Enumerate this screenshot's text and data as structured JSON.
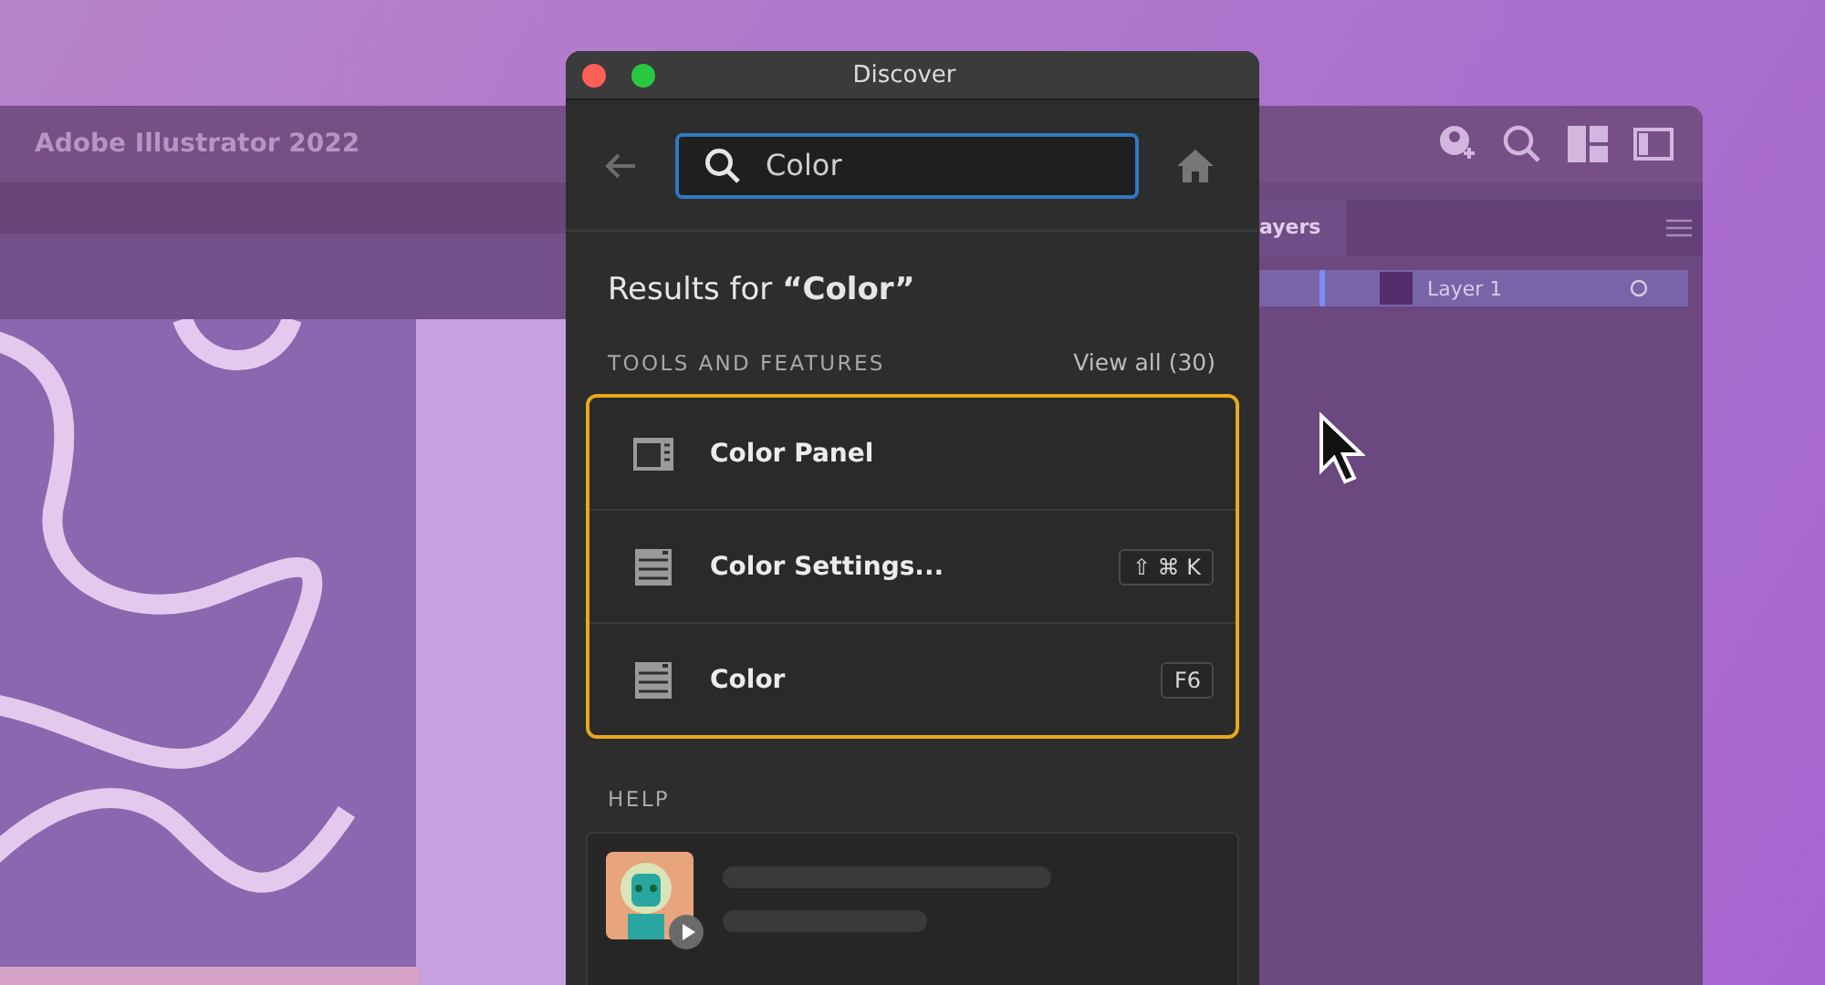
{
  "app_window": {
    "title": "Adobe Illustrator 2022",
    "layers_panel": {
      "tab": "ayers",
      "layers": [
        {
          "name": "Layer 1",
          "selected": true
        }
      ]
    }
  },
  "dialog": {
    "title": "Discover",
    "search": {
      "value": "Color"
    },
    "results_heading": "Results for **“Color”**",
    "section": {
      "title": "TOOLS AND FEATURES",
      "view_all": "View all (30)"
    },
    "results": [
      {
        "kind": "panel",
        "label": "Color Panel"
      },
      {
        "kind": "dialog",
        "label": "Color Settings...",
        "shortcut": "⇧ ⌘ K"
      },
      {
        "kind": "dialog",
        "label": "Color",
        "shortcut": "F6"
      }
    ],
    "help": {
      "title": "HELP"
    }
  }
}
